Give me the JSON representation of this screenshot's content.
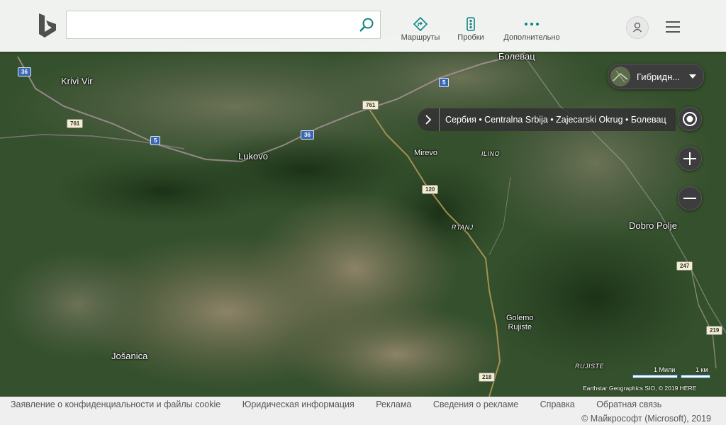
{
  "search": {
    "value": "",
    "placeholder": ""
  },
  "nav": {
    "routes": "Маршруты",
    "traffic": "Пробки",
    "more": "Дополнительно"
  },
  "map_controls": {
    "layer": "Гибридн...",
    "breadcrumb": "Сербия • Centralna Srbija • Zajecarski Okrug • Болевац",
    "scale_miles": "1 Мили",
    "scale_km": "1 км",
    "attribution": "Earthstar Geographics SIO, © 2019 HERE"
  },
  "places": {
    "krivi_vir": "Krivi Vir",
    "lukovo": "Lukovo",
    "mirevo": "Mirevo",
    "ilino": "ILINO",
    "rtanj": "RTANJ",
    "dobro_polje": "Dobro Polje",
    "golemo_rujiste": "Golemo\nRujiste",
    "josanica": "Jošanica",
    "rujiste": "RUJISTE",
    "bolevac": "Болевац"
  },
  "road_shields": {
    "r36a": "36",
    "r761a": "761",
    "r5a": "5",
    "r36b": "36",
    "r761b": "761",
    "r5b": "5",
    "r120": "120",
    "r247": "247",
    "r219": "219",
    "r218": "218"
  },
  "footer": {
    "privacy": "Заявление о конфиденциальности и файлы cookie",
    "legal": "Юридическая информация",
    "ads": "Реклама",
    "about_ads": "Сведения о рекламе",
    "help": "Справка",
    "feedback": "Обратная связь",
    "copyright": "© Майкрософт (Microsoft), 2019"
  },
  "colors": {
    "accent": "#0c8484",
    "header_bg": "#ffffff",
    "controls_bg": "#3d3d3d"
  }
}
